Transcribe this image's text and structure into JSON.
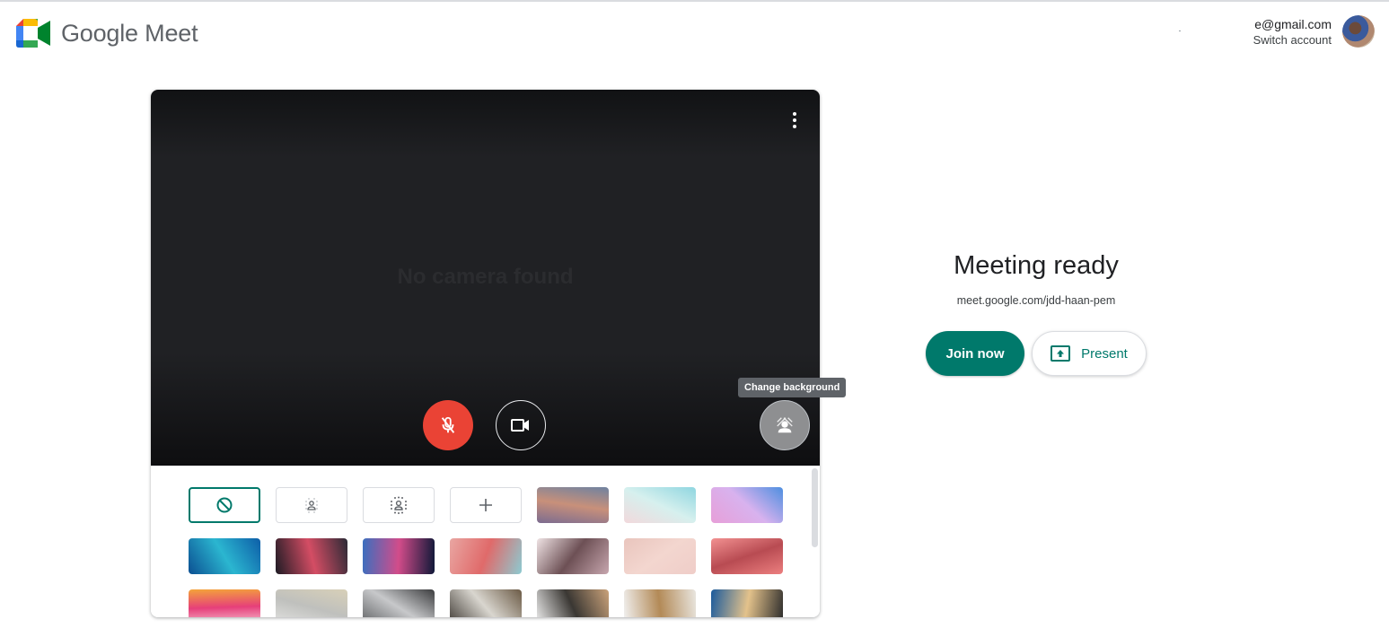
{
  "app": {
    "title": "Google Meet"
  },
  "account": {
    "email": "e@gmail.com",
    "switch_label": "Switch account"
  },
  "preview": {
    "status_text": "No camera found",
    "more_options_icon": "more-vert-icon",
    "controls": {
      "mic": {
        "icon": "mic-off-icon",
        "state": "muted",
        "color": "#ea4335"
      },
      "camera": {
        "icon": "videocam-icon"
      },
      "background": {
        "icon": "change-background-icon",
        "tooltip": "Change background"
      }
    }
  },
  "backgrounds": {
    "options": [
      {
        "name": "no-effect",
        "label": "Turn off visual effects",
        "icon": "block-icon",
        "selected": true
      },
      {
        "name": "slight-blur",
        "label": "Slightly blur background",
        "icon": "blur-light-icon"
      },
      {
        "name": "blur",
        "label": "Blur background",
        "icon": "blur-icon"
      },
      {
        "name": "upload",
        "label": "Add background image",
        "icon": "plus-icon"
      },
      {
        "name": "sunset-sky",
        "colors": [
          "#6f82a0",
          "#c8907a",
          "#7b6c90"
        ]
      },
      {
        "name": "beach",
        "colors": [
          "#8fd6e0",
          "#d6f0ee",
          "#f2d9dc"
        ]
      },
      {
        "name": "pink-clouds",
        "colors": [
          "#4e8fe0",
          "#d8b2ee",
          "#e79fd8"
        ]
      },
      {
        "name": "water",
        "colors": [
          "#0d5ea8",
          "#2bb6d0",
          "#0b4f92"
        ]
      },
      {
        "name": "nebula",
        "colors": [
          "#2b2a36",
          "#d44d64",
          "#1d1b24"
        ]
      },
      {
        "name": "fireworks",
        "colors": [
          "#0f1838",
          "#d24c8a",
          "#3a6fbf"
        ]
      },
      {
        "name": "flowers",
        "colors": [
          "#8ccbd2",
          "#e06a6a",
          "#e9a6a2"
        ]
      },
      {
        "name": "blossoms",
        "colors": [
          "#c7a6ae",
          "#6d5055",
          "#efe3e4"
        ]
      },
      {
        "name": "glitter",
        "colors": [
          "#efcdc8",
          "#f3d6cf",
          "#e9c5bd"
        ]
      },
      {
        "name": "plaid-pink",
        "colors": [
          "#ec7f7f",
          "#b84b52",
          "#f29191"
        ]
      },
      {
        "name": "confetti",
        "colors": [
          "#f7c9d6",
          "#e63f7a",
          "#f4a43a"
        ]
      },
      {
        "name": "white-office",
        "colors": [
          "#e3e3e1",
          "#bfc0bd",
          "#d8d0b8"
        ]
      },
      {
        "name": "industrial",
        "colors": [
          "#5e6062",
          "#c7c8ca",
          "#3b3c3e"
        ]
      },
      {
        "name": "living-room",
        "colors": [
          "#3f3a34",
          "#d9d6cf",
          "#6b5a45"
        ]
      },
      {
        "name": "shelves-dark",
        "colors": [
          "#f0f0f0",
          "#3a3733",
          "#caa27a"
        ]
      },
      {
        "name": "shelves-light",
        "colors": [
          "#f2f2f2",
          "#b38a57",
          "#e9e6e0"
        ]
      },
      {
        "name": "night-cabin",
        "colors": [
          "#1a5a9c",
          "#e3c28b",
          "#2a2a2a"
        ]
      }
    ]
  },
  "meeting": {
    "title": "Meeting ready",
    "link": "meet.google.com/jdd-haan-pem",
    "join_label": "Join now",
    "present_label": "Present",
    "accent": "#00796b"
  }
}
